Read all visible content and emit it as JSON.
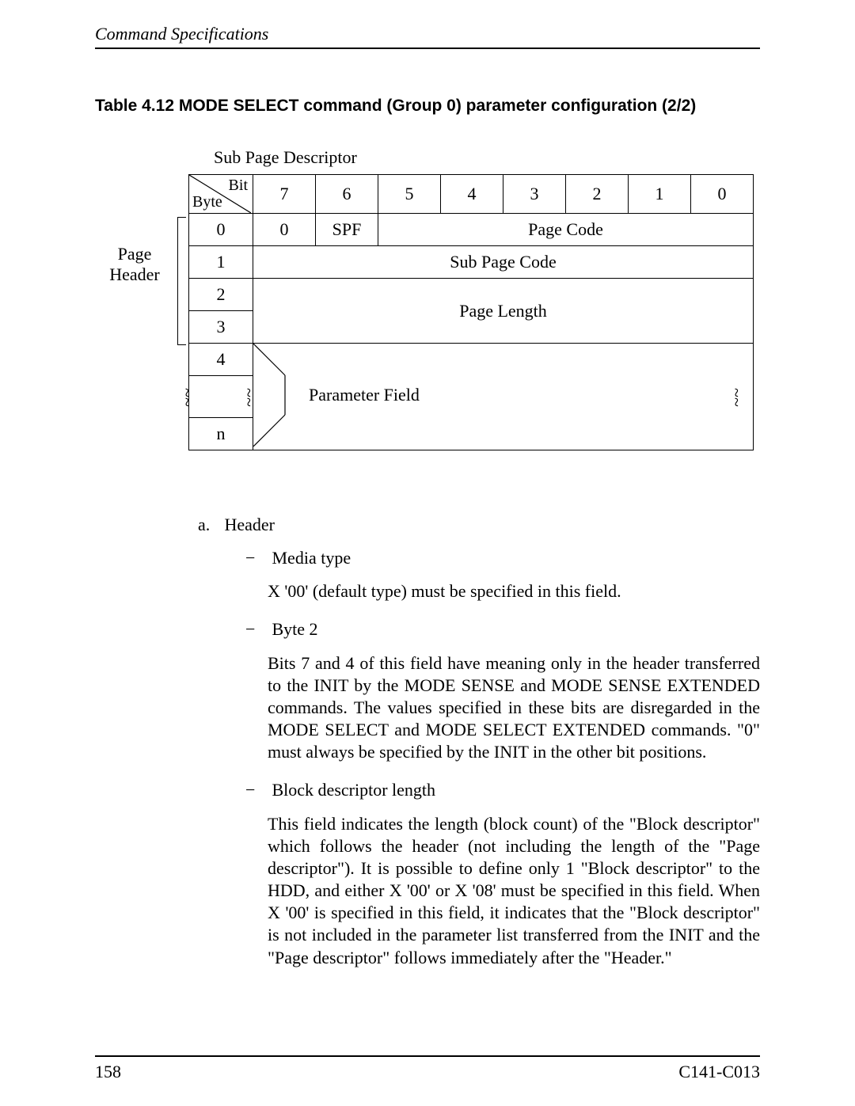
{
  "running_head": "Command Specifications",
  "caption": "Table 4.12  MODE SELECT command (Group 0) parameter configuration (2/2)",
  "subpage_label": "Sub Page Descriptor",
  "page_header_label": "Page\nHeader",
  "header_cell": {
    "bit": "Bit",
    "byte": "Byte"
  },
  "bits": [
    "7",
    "6",
    "5",
    "4",
    "3",
    "2",
    "1",
    "0"
  ],
  "rows": {
    "r0": {
      "byte": "0",
      "c7": "0",
      "c6": "SPF",
      "rest": "Page Code"
    },
    "r1": {
      "byte": "1",
      "all": "Sub Page Code"
    },
    "r2": {
      "byte": "2"
    },
    "r3": {
      "byte": "3"
    },
    "page_length": "Page Length",
    "r4": {
      "byte": "4"
    },
    "param": "Parameter Field",
    "rn": {
      "byte": "n"
    }
  },
  "list": {
    "a_marker": "a.",
    "a_text": "Header",
    "items": [
      {
        "label": "Media type",
        "paras": [
          "X '00' (default type) must be specified in this field."
        ]
      },
      {
        "label": "Byte 2",
        "paras": [
          "Bits 7 and 4 of this field have meaning only in the header transferred to the INIT by the MODE SENSE and MODE SENSE EXTENDED commands.  The values specified in these bits are disregarded in the MODE SELECT and MODE SELECT EXTENDED commands.  \"0\" must always be specified by the INIT in the other bit positions."
        ]
      },
      {
        "label": "Block descriptor length",
        "paras": [
          "This field indicates the length (block count) of the \"Block descriptor\" which follows the header (not including the length of the \"Page descriptor\").  It is possible to define only 1 \"Block descriptor\" to the HDD, and either X '00' or X '08' must be specified in this field.  When X '00' is specified in this field, it indicates that the \"Block descriptor\" is not included in the parameter list transferred from the INIT and the \"Page descriptor\" follows immediately after the \"Header.\""
        ]
      }
    ],
    "dash": "−"
  },
  "footer": {
    "left": "158",
    "right": "C141-C013"
  }
}
